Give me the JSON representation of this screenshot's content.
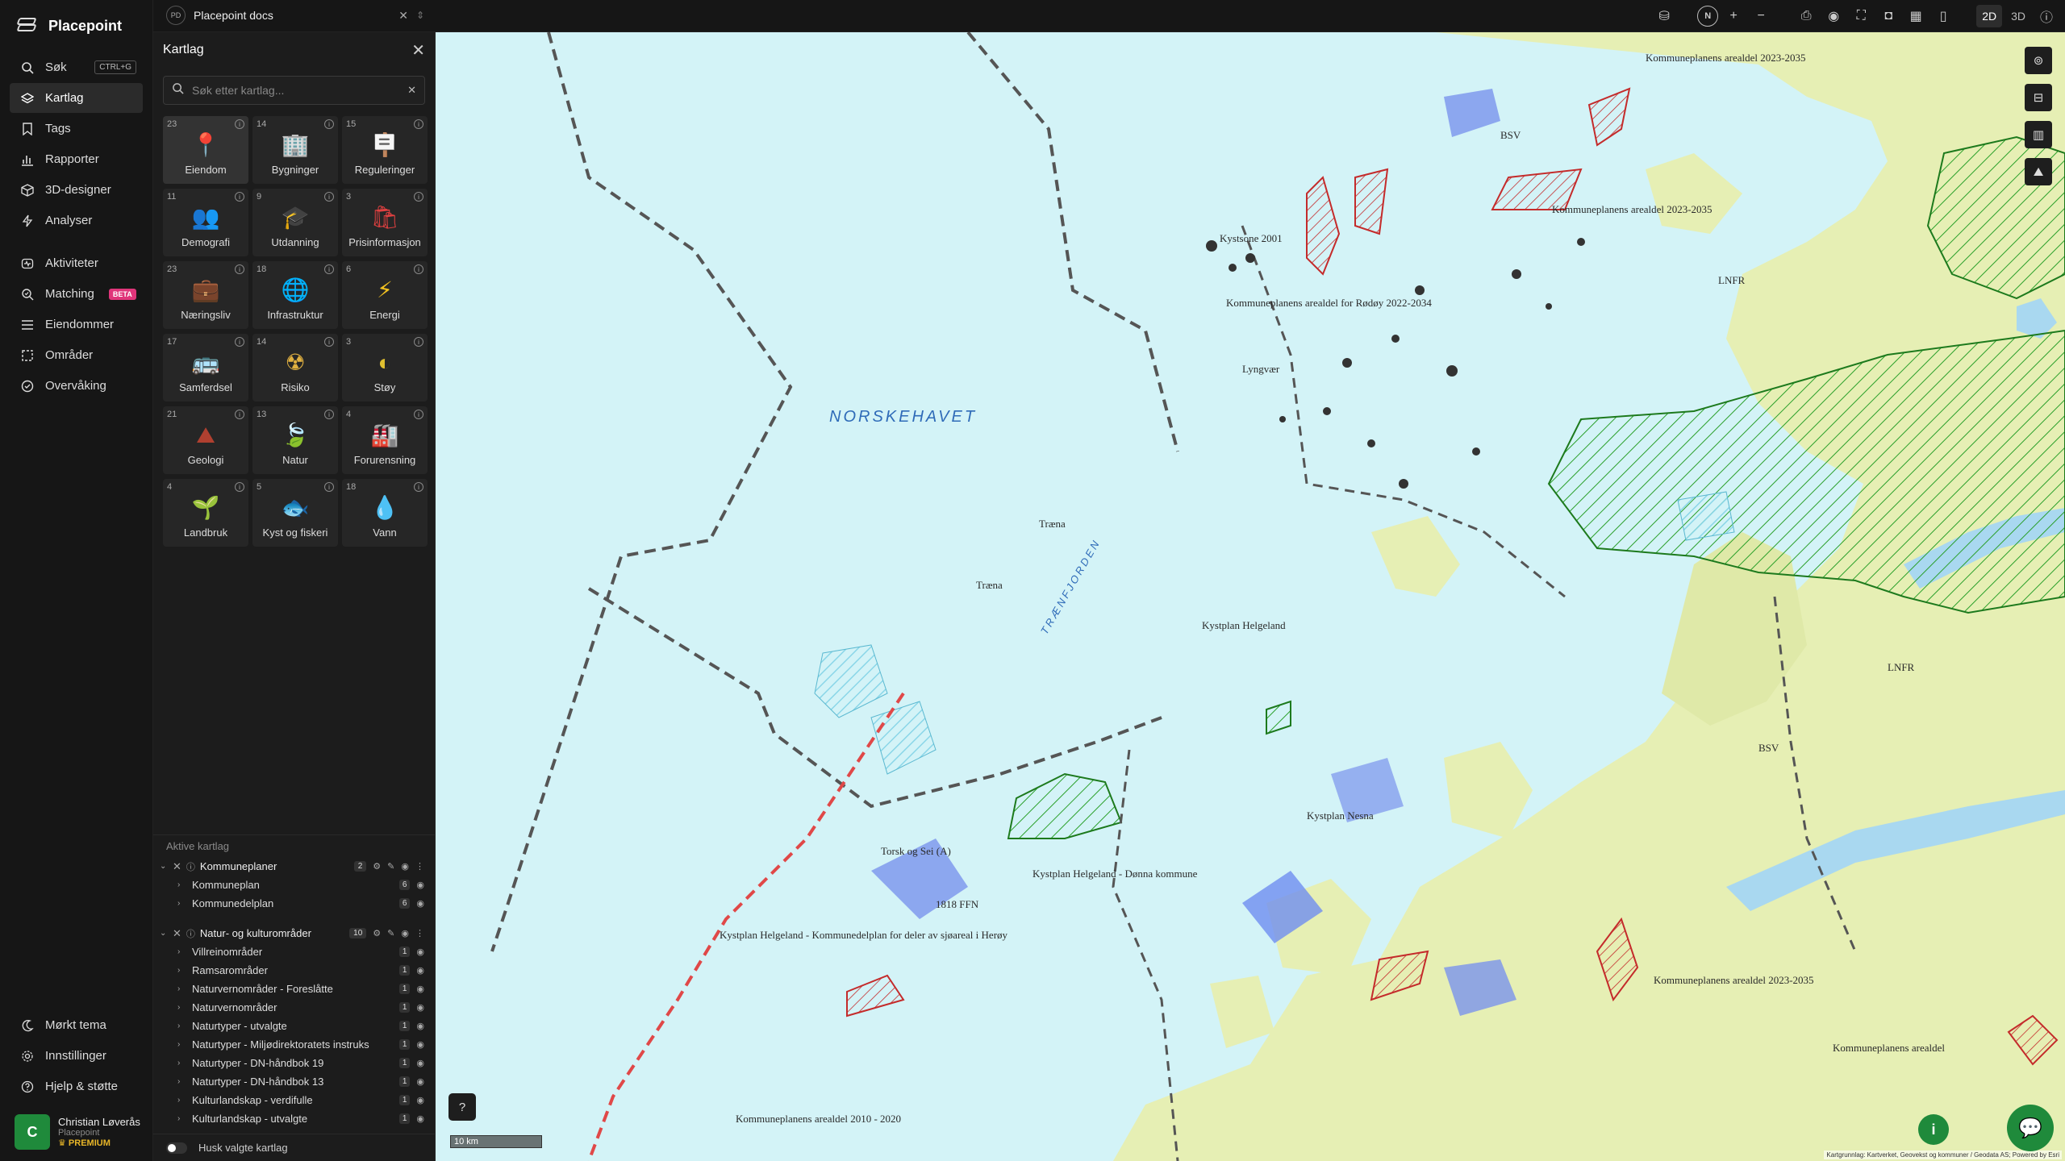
{
  "app": {
    "name": "Placepoint"
  },
  "nav": {
    "items": [
      {
        "label": "Søk",
        "icon": "search-icon",
        "kbd": "CTRL+G"
      },
      {
        "label": "Kartlag",
        "icon": "layers-icon"
      },
      {
        "label": "Tags",
        "icon": "bookmark-icon"
      },
      {
        "label": "Rapporter",
        "icon": "bar-chart-icon"
      },
      {
        "label": "3D-designer",
        "icon": "cube-icon"
      },
      {
        "label": "Analyser",
        "icon": "lightning-icon"
      }
    ],
    "items2": [
      {
        "label": "Aktiviteter",
        "icon": "activity-icon"
      },
      {
        "label": "Matching",
        "icon": "match-icon",
        "badge": "BETA"
      },
      {
        "label": "Eiendommer",
        "icon": "list-icon"
      },
      {
        "label": "Områder",
        "icon": "area-icon"
      },
      {
        "label": "Overvåking",
        "icon": "monitor-icon"
      }
    ],
    "bottom": [
      {
        "label": "Mørkt tema",
        "icon": "moon-icon"
      },
      {
        "label": "Innstillinger",
        "icon": "gear-icon"
      },
      {
        "label": "Hjelp & støtte",
        "icon": "help-icon"
      }
    ],
    "user": {
      "initial": "C",
      "name": "Christian Løverås",
      "org": "Placepoint",
      "plan": "PREMIUM"
    }
  },
  "topbar": {
    "doc_abbr": "PD",
    "doc_name": "Placepoint docs",
    "compass": "N",
    "dim_2d": "2D",
    "dim_3d": "3D"
  },
  "panel": {
    "title": "Kartlag",
    "search_placeholder": "Søk etter kartlag...",
    "tiles": [
      {
        "count": "23",
        "label": "Eiendom",
        "glyph": "📍",
        "color": "#e04040"
      },
      {
        "count": "14",
        "label": "Bygninger",
        "glyph": "🏢",
        "color": "#7aa6d8"
      },
      {
        "count": "15",
        "label": "Reguleringer",
        "glyph": "🪧",
        "color": "#e08a3a"
      },
      {
        "count": "11",
        "label": "Demografi",
        "glyph": "👥",
        "color": "#4fc080"
      },
      {
        "count": "9",
        "label": "Utdanning",
        "glyph": "🎓",
        "color": "#4a6fd8"
      },
      {
        "count": "3",
        "label": "Prisinformasjon",
        "glyph": "🛍",
        "color": "#e04040"
      },
      {
        "count": "23",
        "label": "Næringsliv",
        "glyph": "💼",
        "color": "#e04040"
      },
      {
        "count": "18",
        "label": "Infrastruktur",
        "glyph": "🌐",
        "color": "#4a6fd8"
      },
      {
        "count": "6",
        "label": "Energi",
        "glyph": "⚡",
        "color": "#f0c020"
      },
      {
        "count": "17",
        "label": "Samferdsel",
        "glyph": "🚌",
        "color": "#e0a040"
      },
      {
        "count": "14",
        "label": "Risiko",
        "glyph": "☢",
        "color": "#e0b040"
      },
      {
        "count": "3",
        "label": "Støy",
        "glyph": "◐",
        "color": "#e0c030"
      },
      {
        "count": "21",
        "label": "Geologi",
        "glyph": "⛰",
        "color": "#b04030"
      },
      {
        "count": "13",
        "label": "Natur",
        "glyph": "🍃",
        "color": "#3cb050"
      },
      {
        "count": "4",
        "label": "Forurensning",
        "glyph": "🏭",
        "color": "#7aa6d8"
      },
      {
        "count": "4",
        "label": "Landbruk",
        "glyph": "🌱",
        "color": "#3cb050"
      },
      {
        "count": "5",
        "label": "Kyst og fiskeri",
        "glyph": "🐟",
        "color": "#f0a020"
      },
      {
        "count": "18",
        "label": "Vann",
        "glyph": "💧",
        "color": "#4aa8e8"
      }
    ],
    "active_title": "Aktive kartlag",
    "groups": [
      {
        "name": "Kommuneplaner",
        "count": "2",
        "rows": [
          {
            "name": "Kommuneplan",
            "count": "6"
          },
          {
            "name": "Kommunedelplan",
            "count": "6"
          }
        ]
      },
      {
        "name": "Natur- og kulturområder",
        "count": "10",
        "rows": [
          {
            "name": "Villreinområder",
            "count": "1"
          },
          {
            "name": "Ramsarområder",
            "count": "1"
          },
          {
            "name": "Naturvernområder - Foreslåtte",
            "count": "1"
          },
          {
            "name": "Naturvernområder",
            "count": "1"
          },
          {
            "name": "Naturtyper - utvalgte",
            "count": "1"
          },
          {
            "name": "Naturtyper - Miljødirektoratets instruks",
            "count": "1"
          },
          {
            "name": "Naturtyper - DN-håndbok 19",
            "count": "1"
          },
          {
            "name": "Naturtyper - DN-håndbok 13",
            "count": "1"
          },
          {
            "name": "Kulturlandskap - verdifulle",
            "count": "1"
          },
          {
            "name": "Kulturlandskap - utvalgte",
            "count": "1"
          }
        ]
      }
    ],
    "remember_label": "Husk valgte kartlag"
  },
  "map": {
    "labels": {
      "sea": "NORSKEHAVET",
      "fjord": "TRÆNFJORDEN",
      "kystsone": "Kystsone 2001",
      "rodoy": "Kommuneplanens arealdel for Rødøy 2022-2034",
      "kp_helgeland": "Kystplan Helgeland",
      "kp_nesna": "Kystplan Nesna",
      "kp_donna": "Kystplan Helgeland - Dønna kommune",
      "kp_helg_deler": "Kystplan Helgeland - Kommunedelplan for deler av sjøareal i Herøy",
      "torsk": "Torsk og Sei (A)",
      "kpa_2023": "Kommuneplanens arealdel 2023-2035",
      "kpa_2010": "Kommuneplanens arealdel 2010 - 2020",
      "kpa": "Kommuneplanens arealdel",
      "traena": "Træna",
      "lyngvær": "Lyngvær",
      "lnfr": "LNFR",
      "bsv": "BSV",
      "f1818": "1818 FFN"
    },
    "scale": "10 km",
    "attribution": "Kartgrunnlag: Kartverket, Geovekst og kommuner / Geodata AS; Powered by Esri"
  }
}
